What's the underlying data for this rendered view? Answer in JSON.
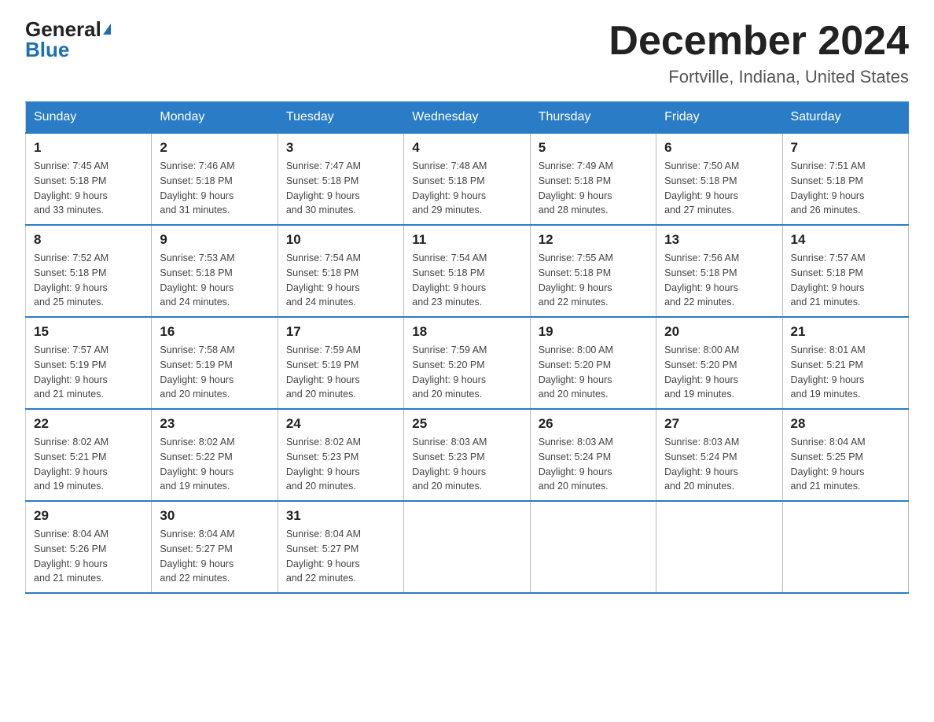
{
  "logo": {
    "general": "General",
    "blue": "Blue"
  },
  "header": {
    "month_year": "December 2024",
    "location": "Fortville, Indiana, United States"
  },
  "columns": [
    "Sunday",
    "Monday",
    "Tuesday",
    "Wednesday",
    "Thursday",
    "Friday",
    "Saturday"
  ],
  "weeks": [
    [
      {
        "day": "1",
        "sunrise": "7:45 AM",
        "sunset": "5:18 PM",
        "daylight": "9 hours and 33 minutes."
      },
      {
        "day": "2",
        "sunrise": "7:46 AM",
        "sunset": "5:18 PM",
        "daylight": "9 hours and 31 minutes."
      },
      {
        "day": "3",
        "sunrise": "7:47 AM",
        "sunset": "5:18 PM",
        "daylight": "9 hours and 30 minutes."
      },
      {
        "day": "4",
        "sunrise": "7:48 AM",
        "sunset": "5:18 PM",
        "daylight": "9 hours and 29 minutes."
      },
      {
        "day": "5",
        "sunrise": "7:49 AM",
        "sunset": "5:18 PM",
        "daylight": "9 hours and 28 minutes."
      },
      {
        "day": "6",
        "sunrise": "7:50 AM",
        "sunset": "5:18 PM",
        "daylight": "9 hours and 27 minutes."
      },
      {
        "day": "7",
        "sunrise": "7:51 AM",
        "sunset": "5:18 PM",
        "daylight": "9 hours and 26 minutes."
      }
    ],
    [
      {
        "day": "8",
        "sunrise": "7:52 AM",
        "sunset": "5:18 PM",
        "daylight": "9 hours and 25 minutes."
      },
      {
        "day": "9",
        "sunrise": "7:53 AM",
        "sunset": "5:18 PM",
        "daylight": "9 hours and 24 minutes."
      },
      {
        "day": "10",
        "sunrise": "7:54 AM",
        "sunset": "5:18 PM",
        "daylight": "9 hours and 24 minutes."
      },
      {
        "day": "11",
        "sunrise": "7:54 AM",
        "sunset": "5:18 PM",
        "daylight": "9 hours and 23 minutes."
      },
      {
        "day": "12",
        "sunrise": "7:55 AM",
        "sunset": "5:18 PM",
        "daylight": "9 hours and 22 minutes."
      },
      {
        "day": "13",
        "sunrise": "7:56 AM",
        "sunset": "5:18 PM",
        "daylight": "9 hours and 22 minutes."
      },
      {
        "day": "14",
        "sunrise": "7:57 AM",
        "sunset": "5:18 PM",
        "daylight": "9 hours and 21 minutes."
      }
    ],
    [
      {
        "day": "15",
        "sunrise": "7:57 AM",
        "sunset": "5:19 PM",
        "daylight": "9 hours and 21 minutes."
      },
      {
        "day": "16",
        "sunrise": "7:58 AM",
        "sunset": "5:19 PM",
        "daylight": "9 hours and 20 minutes."
      },
      {
        "day": "17",
        "sunrise": "7:59 AM",
        "sunset": "5:19 PM",
        "daylight": "9 hours and 20 minutes."
      },
      {
        "day": "18",
        "sunrise": "7:59 AM",
        "sunset": "5:20 PM",
        "daylight": "9 hours and 20 minutes."
      },
      {
        "day": "19",
        "sunrise": "8:00 AM",
        "sunset": "5:20 PM",
        "daylight": "9 hours and 20 minutes."
      },
      {
        "day": "20",
        "sunrise": "8:00 AM",
        "sunset": "5:20 PM",
        "daylight": "9 hours and 19 minutes."
      },
      {
        "day": "21",
        "sunrise": "8:01 AM",
        "sunset": "5:21 PM",
        "daylight": "9 hours and 19 minutes."
      }
    ],
    [
      {
        "day": "22",
        "sunrise": "8:02 AM",
        "sunset": "5:21 PM",
        "daylight": "9 hours and 19 minutes."
      },
      {
        "day": "23",
        "sunrise": "8:02 AM",
        "sunset": "5:22 PM",
        "daylight": "9 hours and 19 minutes."
      },
      {
        "day": "24",
        "sunrise": "8:02 AM",
        "sunset": "5:23 PM",
        "daylight": "9 hours and 20 minutes."
      },
      {
        "day": "25",
        "sunrise": "8:03 AM",
        "sunset": "5:23 PM",
        "daylight": "9 hours and 20 minutes."
      },
      {
        "day": "26",
        "sunrise": "8:03 AM",
        "sunset": "5:24 PM",
        "daylight": "9 hours and 20 minutes."
      },
      {
        "day": "27",
        "sunrise": "8:03 AM",
        "sunset": "5:24 PM",
        "daylight": "9 hours and 20 minutes."
      },
      {
        "day": "28",
        "sunrise": "8:04 AM",
        "sunset": "5:25 PM",
        "daylight": "9 hours and 21 minutes."
      }
    ],
    [
      {
        "day": "29",
        "sunrise": "8:04 AM",
        "sunset": "5:26 PM",
        "daylight": "9 hours and 21 minutes."
      },
      {
        "day": "30",
        "sunrise": "8:04 AM",
        "sunset": "5:27 PM",
        "daylight": "9 hours and 22 minutes."
      },
      {
        "day": "31",
        "sunrise": "8:04 AM",
        "sunset": "5:27 PM",
        "daylight": "9 hours and 22 minutes."
      },
      null,
      null,
      null,
      null
    ]
  ],
  "labels": {
    "sunrise": "Sunrise:",
    "sunset": "Sunset:",
    "daylight": "Daylight:"
  }
}
